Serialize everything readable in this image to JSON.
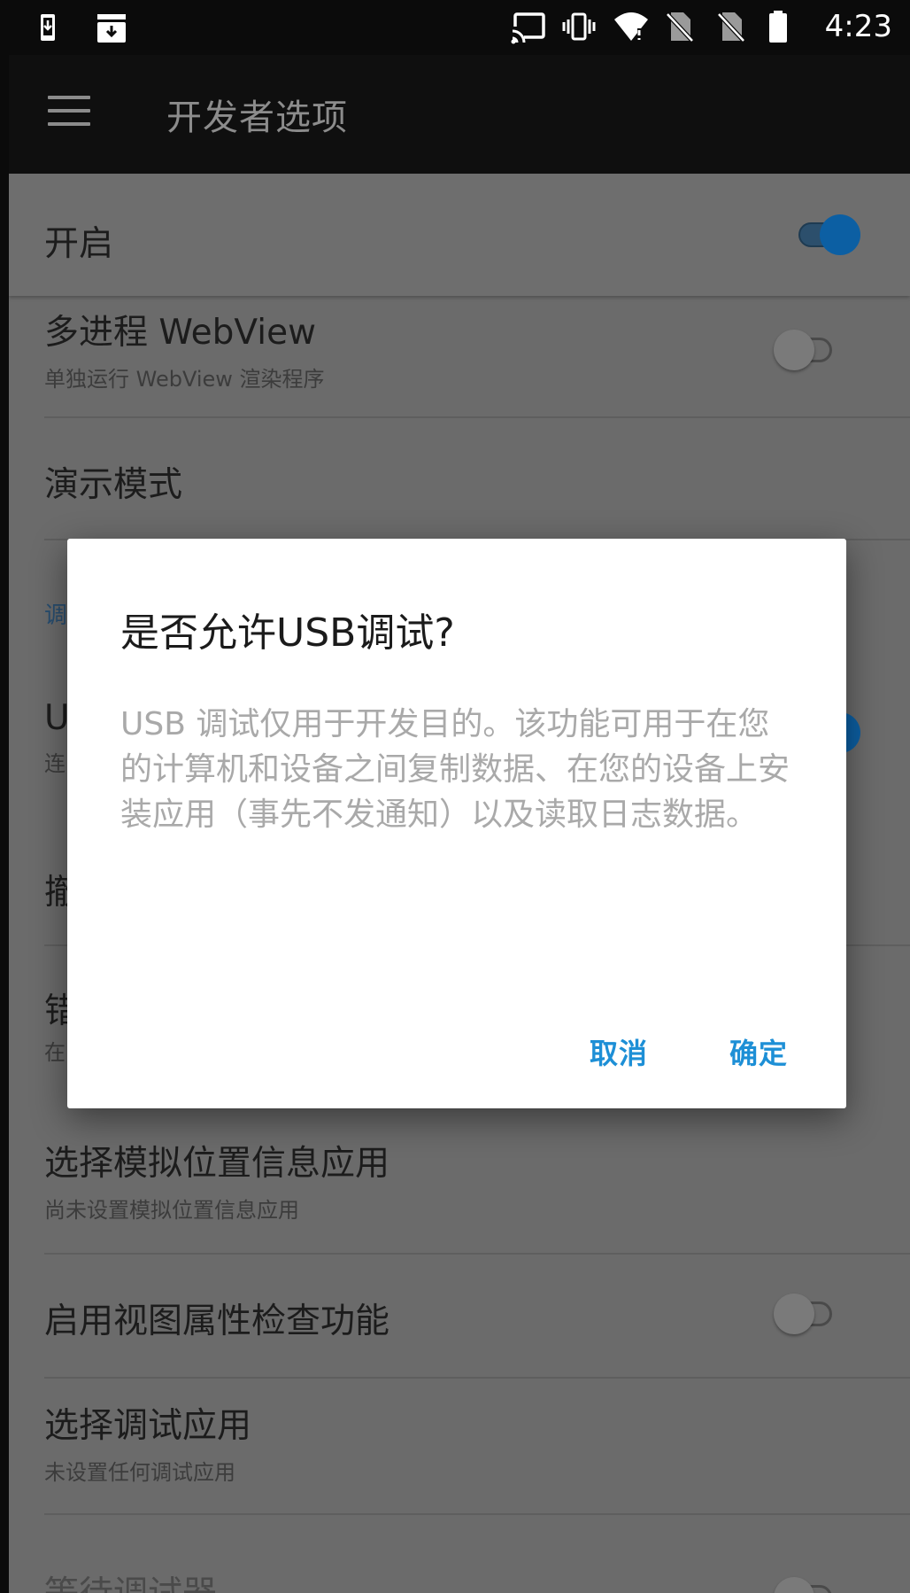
{
  "status_bar": {
    "time": "4:23",
    "left_icons": [
      "download-notification-icon",
      "storage-notification-icon"
    ],
    "right_icons": [
      "cast-icon",
      "vibrate-icon",
      "wifi-icon",
      "no-sim-icon",
      "no-sim-icon",
      "battery-icon"
    ]
  },
  "toolbar": {
    "title": "开发者选项",
    "menu_icon": "hamburger-menu-icon"
  },
  "settings": {
    "master_switch": {
      "title": "开启",
      "enabled": true
    },
    "items": [
      {
        "title": "多进程 WebView",
        "subtitle": "单独运行 WebView 渲染程序",
        "toggle": false
      },
      {
        "title": "演示模式"
      },
      {
        "section_label": "调"
      },
      {
        "title": "U",
        "subtitle": "连",
        "toggle": true
      },
      {
        "title": "撤"
      },
      {
        "title": "错",
        "subtitle": "在"
      },
      {
        "title": "选择模拟位置信息应用",
        "subtitle": "尚未设置模拟位置信息应用"
      },
      {
        "title": "启用视图属性检查功能",
        "toggle": false
      },
      {
        "title": "选择调试应用",
        "subtitle": "未设置任何调试应用"
      },
      {
        "title": "等待调试器"
      }
    ]
  },
  "dialog": {
    "title": "是否允许USB调试?",
    "message": "USB 调试仅用于开发目的。该功能可用于在您的计算机和设备之间复制数据、在您的设备上安装应用（事先不发通知）以及读取日志数据。",
    "cancel_label": "取消",
    "ok_label": "确定"
  },
  "colors": {
    "accent": "#1d8fd6",
    "scrim_background": "#6b6b6b",
    "toolbar_background": "#0f0f0f"
  }
}
